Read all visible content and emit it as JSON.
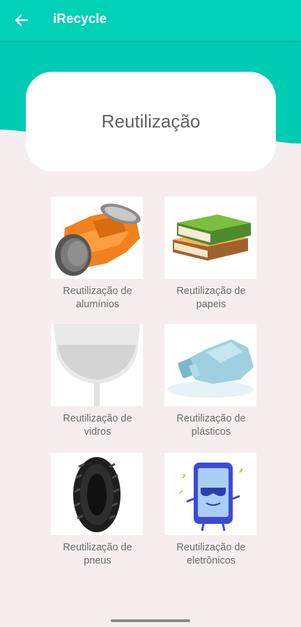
{
  "app_bar": {
    "title": "iRecycle",
    "back_icon": "arrow-left-icon",
    "color": "#00d1b7"
  },
  "hero": {
    "title": "Reutilização"
  },
  "tiles": [
    {
      "line1": "Reutilização de",
      "line2": "alumínios",
      "icon": "aluminum-can-icon"
    },
    {
      "line1": "Reutilização de",
      "line2": "papeis",
      "icon": "books-icon"
    },
    {
      "line1": "Reutilização de",
      "line2": "vidros",
      "icon": "wine-glass-icon"
    },
    {
      "line1": "Reutilização de",
      "line2": "plásticos",
      "icon": "plastic-bottle-icon"
    },
    {
      "line1": "Reutilização de",
      "line2": "pneus",
      "icon": "tire-icon"
    },
    {
      "line1": "Reutilização de",
      "line2": "eletrônicos",
      "icon": "smartphone-icon"
    }
  ]
}
